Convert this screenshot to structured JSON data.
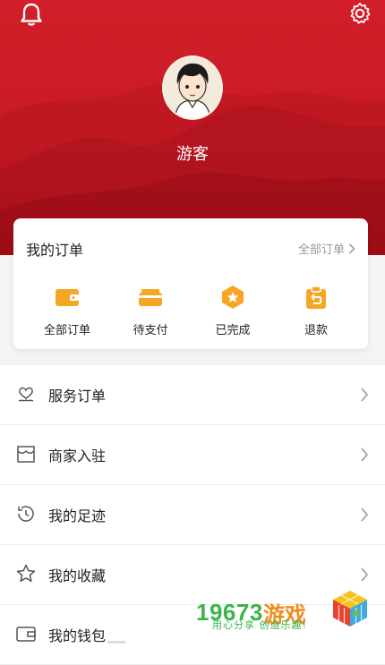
{
  "header": {
    "username": "游客"
  },
  "orders": {
    "title": "我的订单",
    "all_link": "全部订单",
    "items": [
      {
        "label": "全部订单",
        "icon": "wallet-icon"
      },
      {
        "label": "待支付",
        "icon": "card-icon"
      },
      {
        "label": "已完成",
        "icon": "star-badge-icon"
      },
      {
        "label": "退款",
        "icon": "refund-icon"
      }
    ]
  },
  "menu": {
    "items": [
      {
        "label": "服务订单",
        "icon": "heart-hand-icon"
      },
      {
        "label": "商家入驻",
        "icon": "store-icon"
      },
      {
        "label": "我的足迹",
        "icon": "history-icon"
      },
      {
        "label": "我的收藏",
        "icon": "star-icon"
      },
      {
        "label": "我的钱包",
        "icon": "wallet-outline-icon"
      }
    ]
  },
  "watermark": {
    "number": "19673",
    "brand": "游戏",
    "slogan": "用心分享 创造乐趣!"
  },
  "colors": {
    "header_red": "#c81b25",
    "accent_orange": "#f5a623",
    "watermark_green": "#3bb54a",
    "watermark_orange": "#f28a1c"
  }
}
